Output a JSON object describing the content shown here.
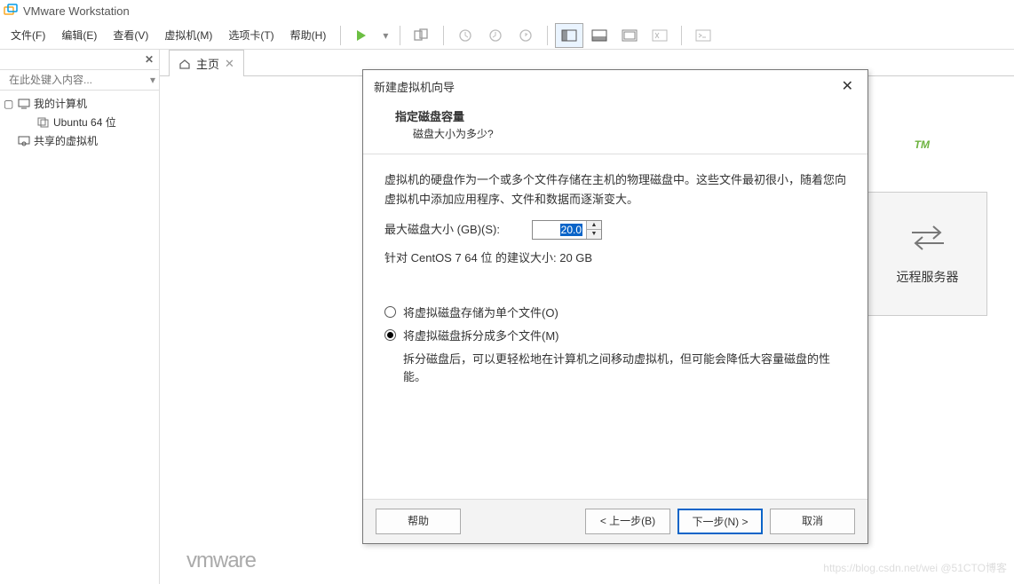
{
  "app": {
    "title": "VMware Workstation"
  },
  "menu": {
    "file": "文件(F)",
    "edit": "编辑(E)",
    "view": "查看(V)",
    "vm": "虚拟机(M)",
    "tabs": "选项卡(T)",
    "help": "帮助(H)"
  },
  "sidebar": {
    "close_label": "✕",
    "search_placeholder": "在此处键入内容...",
    "nodes": {
      "my_computer": "我的计算机",
      "ubuntu": "Ubuntu 64 位",
      "shared": "共享的虚拟机"
    }
  },
  "tabs": {
    "home": "主页"
  },
  "welcome": {
    "tm": "TM",
    "card_label": "远程服务器",
    "logo": "vmware"
  },
  "dialog": {
    "title": "新建虚拟机向导",
    "heading": "指定磁盘容量",
    "subheading": "磁盘大小为多少?",
    "info": "虚拟机的硬盘作为一个或多个文件存储在主机的物理磁盘中。这些文件最初很小，随着您向虚拟机中添加应用程序、文件和数据而逐渐变大。",
    "size_label": "最大磁盘大小 (GB)(S):",
    "size_value": "20.0",
    "recommend": "针对 CentOS 7 64 位 的建议大小: 20 GB",
    "radio1": "将虚拟磁盘存储为单个文件(O)",
    "radio2": "将虚拟磁盘拆分成多个文件(M)",
    "radio2_desc": "拆分磁盘后，可以更轻松地在计算机之间移动虚拟机，但可能会降低大容量磁盘的性能。",
    "btn_help": "帮助",
    "btn_back": "< 上一步(B)",
    "btn_next": "下一步(N) >",
    "btn_cancel": "取消"
  },
  "watermark": "https://blog.csdn.net/wei @51CTO博客"
}
